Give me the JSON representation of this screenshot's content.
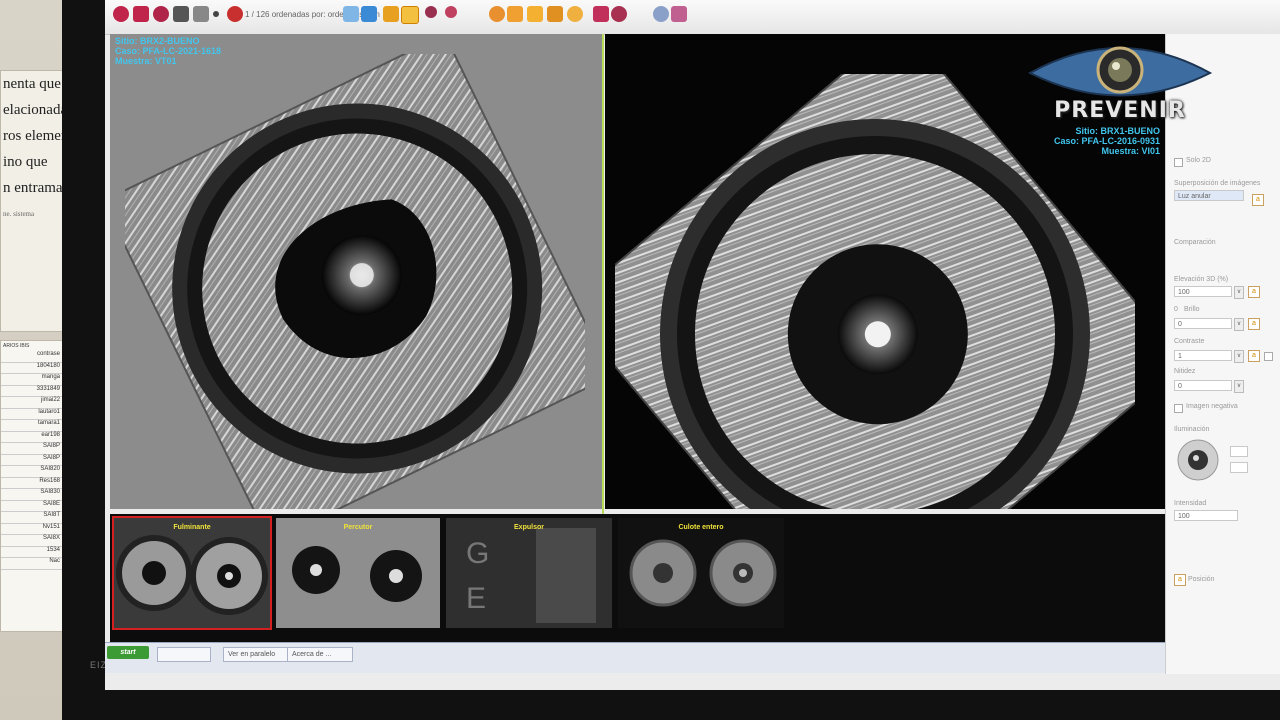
{
  "document_paper": {
    "lines": [
      "nenta que",
      "elacionada",
      "ros elemen",
      "ino que",
      "n entrama"
    ],
    "small_note": "ne. sistema"
  },
  "table_paper": {
    "header": "ARIOS IBIS",
    "cells": [
      "contrase",
      "1804180",
      "manga",
      "3331849",
      "jimai22",
      "lautaro1",
      "tamara1",
      "ear198",
      "SAI8P",
      "SAI8P",
      "SAI820",
      "Res168",
      "SAI830",
      "SAI8E",
      "SAI8T",
      "Nv151",
      "SAI8X",
      "1534",
      "Nac"
    ]
  },
  "monitor_brand": "EIZO",
  "toolbar": {
    "counter_text": "1 / 126 ordenadas por: orden posicion"
  },
  "left_view": {
    "info": {
      "sitio": "Sitio: BRX2-BUENO",
      "caso": "Caso: PFA-LC-2021-1618",
      "muestra": "Muestra: VT01"
    }
  },
  "right_view": {
    "info": {
      "sitio": "Sitio: BRX1-BUENO",
      "caso": "Caso: PFA-LC-2016-0931",
      "muestra": "Muestra: VI01"
    }
  },
  "thumbnails": [
    {
      "label": "Fulminante",
      "active": true
    },
    {
      "label": "Percutor",
      "active": false
    },
    {
      "label": "Expulsor",
      "active": false
    },
    {
      "label": "Culote entero",
      "active": false
    }
  ],
  "right_panel": {
    "solo_2d": "Solo 2D",
    "superposicion_label": "Superposición de imágenes",
    "superposicion_value": "Luz anular",
    "comparacion": "Comparación",
    "elevacion_label": "Elevación 3D (%)",
    "elevacion_value": "100",
    "brillo_label": "Brillo",
    "brillo_value": "0",
    "contraste_label": "Contraste",
    "contraste_value": "1",
    "nitidez_label": "Nitidez",
    "nitidez_value": "0",
    "imagen_negativa": "Imagen negativa",
    "iluminacion": "Iluminación",
    "intensidad_label": "Intensidad",
    "intensidad_value": "100",
    "posicion": "Posición"
  },
  "taskbar": {
    "start_label": "start",
    "items": [
      "",
      "Ver en paralelo",
      "Acerca de ..."
    ]
  },
  "watermark": {
    "text": "PREVENIR"
  },
  "colors": {
    "info_text": "#41c6ee",
    "thumb_label": "#f0e23a",
    "active_outline": "#d32020",
    "divider": "#b8dc5a"
  }
}
